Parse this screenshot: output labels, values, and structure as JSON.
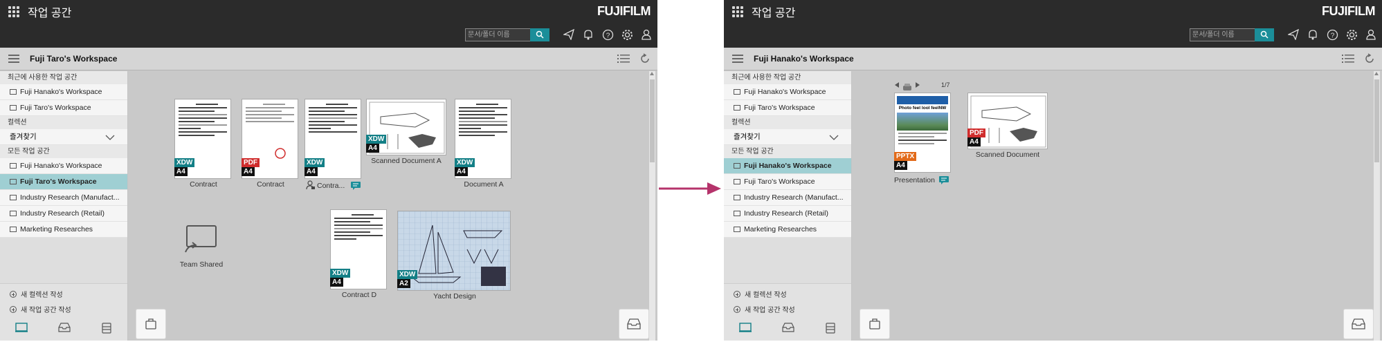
{
  "app": {
    "grid_icon": "apps-grid-icon",
    "title": "작업 공간",
    "brand": "FUJIFILM"
  },
  "search": {
    "placeholder": "문서/폴더 이름"
  },
  "sidebar_common": {
    "recent_header": "최근에 사용한 작업 공간",
    "collection_header": "컬렉션",
    "favorites": "즐겨찾기",
    "all_header": "모든 작업 공간",
    "all_items": [
      "Fuji Hanako's Workspace",
      "Fuji Taro's Workspace",
      "Industry Research (Manufact...",
      "Industry Research (Retail)",
      "Marketing Researches"
    ],
    "recent_items": [
      "Fuji Hanako's Workspace",
      "Fuji Taro's Workspace"
    ],
    "new_collection": "새 컬렉션 작성",
    "new_workspace": "새 작업 공간 작성"
  },
  "left": {
    "workspace_title": "Fuji Taro's Workspace",
    "active_item": "Fuji Taro's Workspace",
    "documents": [
      {
        "label": "Contract",
        "format": "XDW",
        "size": "A4"
      },
      {
        "label": "Contract",
        "format": "PDF",
        "size": "A4"
      },
      {
        "label": "Contra...",
        "format": "XDW",
        "size": "A4"
      },
      {
        "label": "Scanned Document A",
        "format": "XDW",
        "size": "A4"
      },
      {
        "label": "Document A",
        "format": "XDW",
        "size": "A4"
      },
      {
        "label": "Team Shared"
      },
      {
        "label": "Contract D",
        "format": "XDW",
        "size": "A4"
      },
      {
        "label": "Yacht Design",
        "format": "XDW",
        "size": "A2"
      }
    ]
  },
  "right": {
    "workspace_title": "Fuji Hanako's Workspace",
    "active_item": "Fuji Hanako's Workspace",
    "page_counter": "1/7",
    "slide_title": "Photo feel lool feelNW",
    "documents": [
      {
        "label": "Presentation",
        "format": "PPTX",
        "size": "A4"
      },
      {
        "label": "Scanned Document",
        "format": "PDF",
        "size": "A4"
      }
    ]
  },
  "colors": {
    "topbar": "#2b2b2b",
    "accent": "#1b8e99",
    "active": "#9fcfd3",
    "arrow": "#b5336b"
  }
}
